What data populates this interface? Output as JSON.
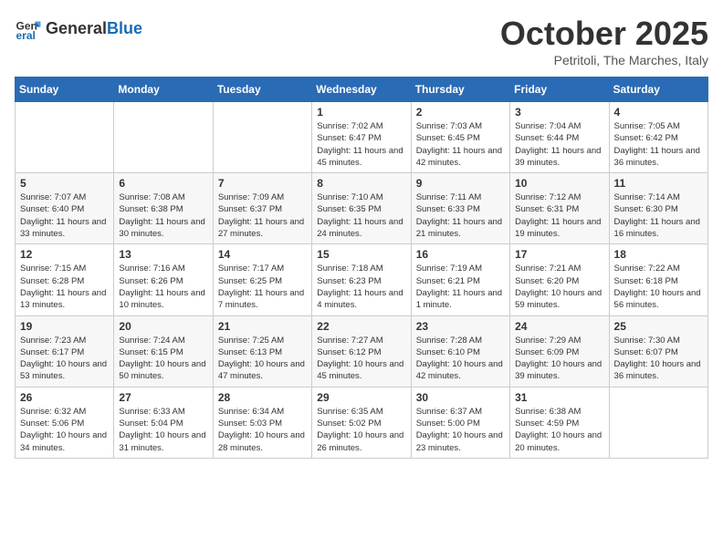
{
  "logo": {
    "general": "General",
    "blue": "Blue"
  },
  "header": {
    "month": "October 2025",
    "location": "Petritoli, The Marches, Italy"
  },
  "weekdays": [
    "Sunday",
    "Monday",
    "Tuesday",
    "Wednesday",
    "Thursday",
    "Friday",
    "Saturday"
  ],
  "weeks": [
    [
      {
        "day": "",
        "info": ""
      },
      {
        "day": "",
        "info": ""
      },
      {
        "day": "",
        "info": ""
      },
      {
        "day": "1",
        "info": "Sunrise: 7:02 AM\nSunset: 6:47 PM\nDaylight: 11 hours and 45 minutes."
      },
      {
        "day": "2",
        "info": "Sunrise: 7:03 AM\nSunset: 6:45 PM\nDaylight: 11 hours and 42 minutes."
      },
      {
        "day": "3",
        "info": "Sunrise: 7:04 AM\nSunset: 6:44 PM\nDaylight: 11 hours and 39 minutes."
      },
      {
        "day": "4",
        "info": "Sunrise: 7:05 AM\nSunset: 6:42 PM\nDaylight: 11 hours and 36 minutes."
      }
    ],
    [
      {
        "day": "5",
        "info": "Sunrise: 7:07 AM\nSunset: 6:40 PM\nDaylight: 11 hours and 33 minutes."
      },
      {
        "day": "6",
        "info": "Sunrise: 7:08 AM\nSunset: 6:38 PM\nDaylight: 11 hours and 30 minutes."
      },
      {
        "day": "7",
        "info": "Sunrise: 7:09 AM\nSunset: 6:37 PM\nDaylight: 11 hours and 27 minutes."
      },
      {
        "day": "8",
        "info": "Sunrise: 7:10 AM\nSunset: 6:35 PM\nDaylight: 11 hours and 24 minutes."
      },
      {
        "day": "9",
        "info": "Sunrise: 7:11 AM\nSunset: 6:33 PM\nDaylight: 11 hours and 21 minutes."
      },
      {
        "day": "10",
        "info": "Sunrise: 7:12 AM\nSunset: 6:31 PM\nDaylight: 11 hours and 19 minutes."
      },
      {
        "day": "11",
        "info": "Sunrise: 7:14 AM\nSunset: 6:30 PM\nDaylight: 11 hours and 16 minutes."
      }
    ],
    [
      {
        "day": "12",
        "info": "Sunrise: 7:15 AM\nSunset: 6:28 PM\nDaylight: 11 hours and 13 minutes."
      },
      {
        "day": "13",
        "info": "Sunrise: 7:16 AM\nSunset: 6:26 PM\nDaylight: 11 hours and 10 minutes."
      },
      {
        "day": "14",
        "info": "Sunrise: 7:17 AM\nSunset: 6:25 PM\nDaylight: 11 hours and 7 minutes."
      },
      {
        "day": "15",
        "info": "Sunrise: 7:18 AM\nSunset: 6:23 PM\nDaylight: 11 hours and 4 minutes."
      },
      {
        "day": "16",
        "info": "Sunrise: 7:19 AM\nSunset: 6:21 PM\nDaylight: 11 hours and 1 minute."
      },
      {
        "day": "17",
        "info": "Sunrise: 7:21 AM\nSunset: 6:20 PM\nDaylight: 10 hours and 59 minutes."
      },
      {
        "day": "18",
        "info": "Sunrise: 7:22 AM\nSunset: 6:18 PM\nDaylight: 10 hours and 56 minutes."
      }
    ],
    [
      {
        "day": "19",
        "info": "Sunrise: 7:23 AM\nSunset: 6:17 PM\nDaylight: 10 hours and 53 minutes."
      },
      {
        "day": "20",
        "info": "Sunrise: 7:24 AM\nSunset: 6:15 PM\nDaylight: 10 hours and 50 minutes."
      },
      {
        "day": "21",
        "info": "Sunrise: 7:25 AM\nSunset: 6:13 PM\nDaylight: 10 hours and 47 minutes."
      },
      {
        "day": "22",
        "info": "Sunrise: 7:27 AM\nSunset: 6:12 PM\nDaylight: 10 hours and 45 minutes."
      },
      {
        "day": "23",
        "info": "Sunrise: 7:28 AM\nSunset: 6:10 PM\nDaylight: 10 hours and 42 minutes."
      },
      {
        "day": "24",
        "info": "Sunrise: 7:29 AM\nSunset: 6:09 PM\nDaylight: 10 hours and 39 minutes."
      },
      {
        "day": "25",
        "info": "Sunrise: 7:30 AM\nSunset: 6:07 PM\nDaylight: 10 hours and 36 minutes."
      }
    ],
    [
      {
        "day": "26",
        "info": "Sunrise: 6:32 AM\nSunset: 5:06 PM\nDaylight: 10 hours and 34 minutes."
      },
      {
        "day": "27",
        "info": "Sunrise: 6:33 AM\nSunset: 5:04 PM\nDaylight: 10 hours and 31 minutes."
      },
      {
        "day": "28",
        "info": "Sunrise: 6:34 AM\nSunset: 5:03 PM\nDaylight: 10 hours and 28 minutes."
      },
      {
        "day": "29",
        "info": "Sunrise: 6:35 AM\nSunset: 5:02 PM\nDaylight: 10 hours and 26 minutes."
      },
      {
        "day": "30",
        "info": "Sunrise: 6:37 AM\nSunset: 5:00 PM\nDaylight: 10 hours and 23 minutes."
      },
      {
        "day": "31",
        "info": "Sunrise: 6:38 AM\nSunset: 4:59 PM\nDaylight: 10 hours and 20 minutes."
      },
      {
        "day": "",
        "info": ""
      }
    ]
  ]
}
